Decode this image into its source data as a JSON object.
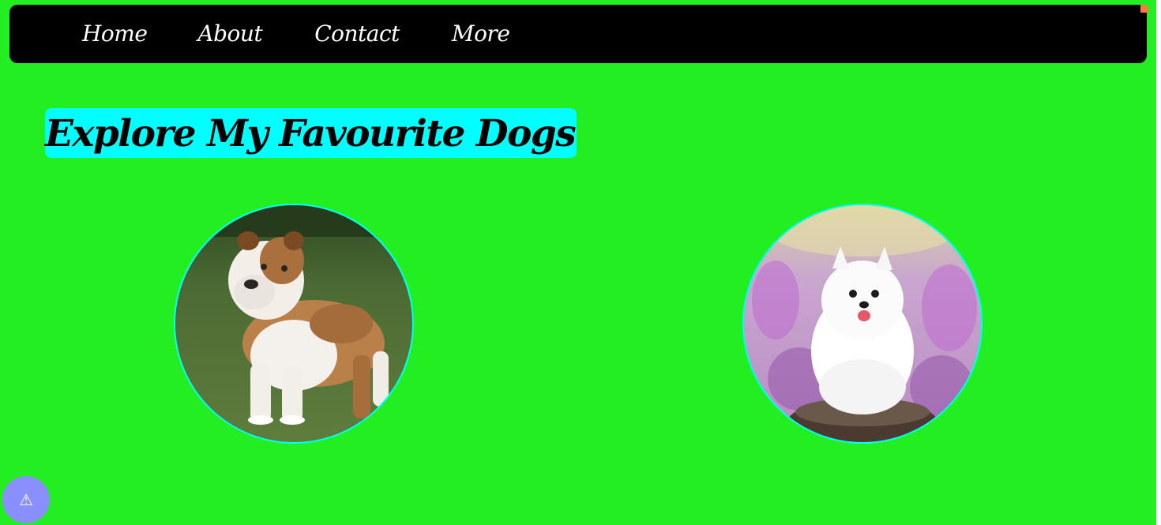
{
  "nav": {
    "items": [
      {
        "label": "Home"
      },
      {
        "label": "About"
      },
      {
        "label": "Contact"
      },
      {
        "label": "More"
      }
    ]
  },
  "main": {
    "heading": "Explore My Favourite Dogs"
  },
  "colors": {
    "page_background": "#22ee22",
    "navbar": "#000000",
    "heading_highlight": "#00ffff",
    "image_border": "#00ffff",
    "alert_button": "#8a8fff"
  },
  "icons": {
    "alert": "warning-icon"
  },
  "alert_button": {
    "glyph": "⚠"
  }
}
